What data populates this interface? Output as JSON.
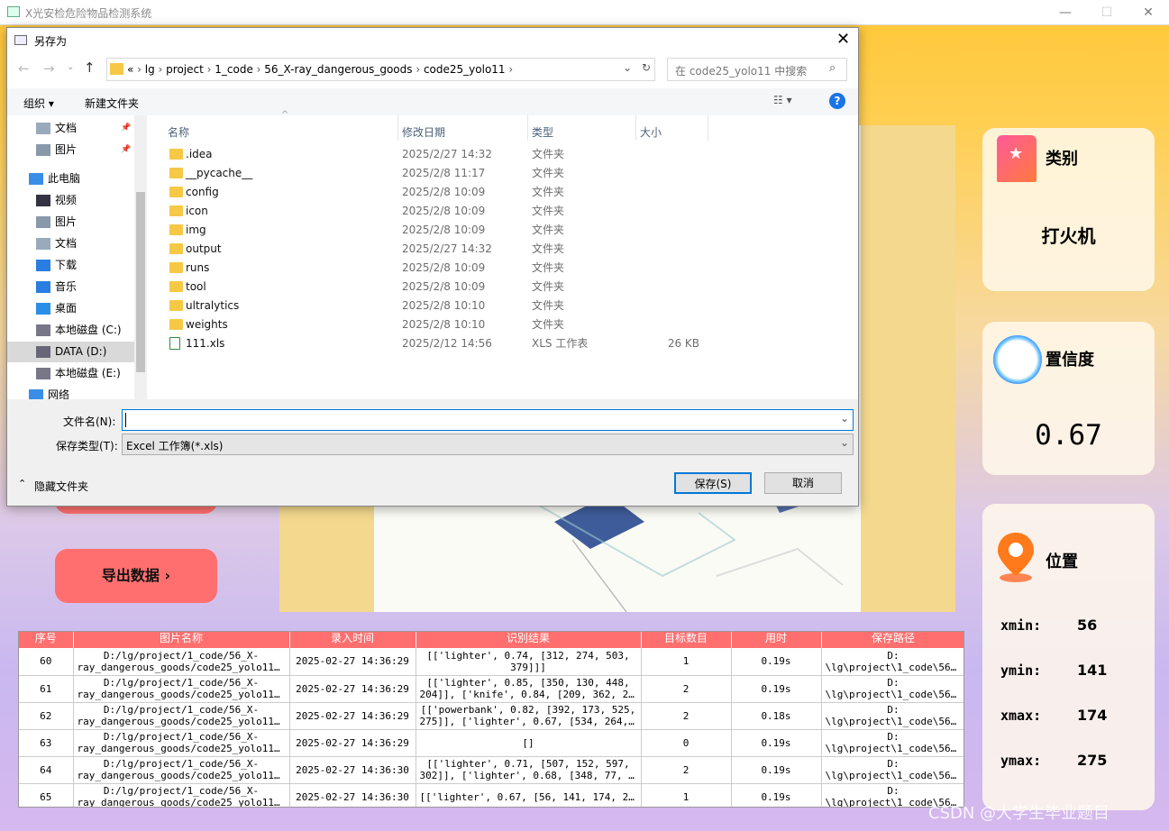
{
  "window": {
    "title": "X光安检危险物品检测系统",
    "min": "—",
    "max": "☐",
    "close": "✕"
  },
  "sidebar_buttons": {
    "export_label": "导出数据 ›"
  },
  "result_cards": {
    "category": {
      "title": "类别",
      "value": "打火机"
    },
    "confidence": {
      "title": "置信度",
      "value": "0.67"
    },
    "position": {
      "title": "位置",
      "xmin_label": "xmin:",
      "xmin": "56",
      "ymin_label": "ymin:",
      "ymin": "141",
      "xmax_label": "xmax:",
      "xmax": "174",
      "ymax_label": "ymax:",
      "ymax": "275"
    }
  },
  "table": {
    "headers": [
      "序号",
      "图片名称",
      "录入时间",
      "识别结果",
      "目标数目",
      "用时",
      "保存路径"
    ],
    "rows": [
      {
        "id": "60",
        "name1": "D:/lg/project/1_code/56_X-",
        "name2": "ray_dangerous_goods/code25_yolo11/im…",
        "time": "2025-02-27 14:36:29",
        "res1": "[['lighter', 0.74, [312, 274, 503,",
        "res2": "379]]]",
        "count": "1",
        "dur": "0.19s",
        "path1": "D:",
        "path2": "\\lg\\project\\1_code\\56_X…"
      },
      {
        "id": "61",
        "name1": "D:/lg/project/1_code/56_X-",
        "name2": "ray_dangerous_goods/code25_yolo11/im…",
        "time": "2025-02-27 14:36:29",
        "res1": "[['lighter', 0.85, [350, 130, 448,",
        "res2": "204]], ['knife', 0.84, [209, 362, 267,…",
        "count": "2",
        "dur": "0.19s",
        "path1": "D:",
        "path2": "\\lg\\project\\1_code\\56_X…"
      },
      {
        "id": "62",
        "name1": "D:/lg/project/1_code/56_X-",
        "name2": "ray_dangerous_goods/code25_yolo11/im…",
        "time": "2025-02-27 14:36:29",
        "res1": "[['powerbank', 0.82, [392, 173, 525,",
        "res2": "275]], ['lighter', 0.67, [534, 264, 59…",
        "count": "2",
        "dur": "0.18s",
        "path1": "D:",
        "path2": "\\lg\\project\\1_code\\56_X…"
      },
      {
        "id": "63",
        "name1": "D:/lg/project/1_code/56_X-",
        "name2": "ray_dangerous_goods/code25_yolo11/im…",
        "time": "2025-02-27 14:36:29",
        "res1": "[]",
        "res2": "",
        "count": "0",
        "dur": "0.19s",
        "path1": "D:",
        "path2": "\\lg\\project\\1_code\\56_X…"
      },
      {
        "id": "64",
        "name1": "D:/lg/project/1_code/56_X-",
        "name2": "ray_dangerous_goods/code25_yolo11/im…",
        "time": "2025-02-27 14:36:30",
        "res1": "[['lighter', 0.71, [507, 152, 597,",
        "res2": "302]], ['lighter', 0.68, [348, 77, 413…",
        "count": "2",
        "dur": "0.19s",
        "path1": "D:",
        "path2": "\\lg\\project\\1_code\\56_X…"
      },
      {
        "id": "65",
        "name1": "D:/lg/project/1_code/56_X-",
        "name2": "ray_dangerous_goods/code25_yolo11/im…",
        "time": "2025-02-27 14:36:30",
        "res1": "[['lighter', 0.67, [56, 141, 174, 275]]]",
        "res2": "",
        "count": "1",
        "dur": "0.19s",
        "path1": "D:",
        "path2": "\\lg\\project\\1_code\\56_X…"
      }
    ]
  },
  "watermark": "CSDN @大学生毕业题目",
  "dialog": {
    "title": "另存为",
    "breadcrumb": [
      "«",
      "lg",
      "project",
      "1_code",
      "56_X-ray_dangerous_goods",
      "code25_yolo11"
    ],
    "search_placeholder": "在 code25_yolo11 中搜索",
    "organize": "组织 ▾",
    "new_folder": "新建文件夹",
    "nav_items": [
      "文档",
      "图片",
      "此电脑",
      "视频",
      "图片",
      "文档",
      "下载",
      "音乐",
      "桌面",
      "本地磁盘 (C:)",
      "DATA (D:)",
      "本地磁盘 (E:)",
      "网络"
    ],
    "columns": [
      "名称",
      "修改日期",
      "类型",
      "大小"
    ],
    "files": [
      {
        "name": ".idea",
        "date": "2025/2/27 14:32",
        "type": "文件夹",
        "size": ""
      },
      {
        "name": "__pycache__",
        "date": "2025/2/8 11:17",
        "type": "文件夹",
        "size": ""
      },
      {
        "name": "config",
        "date": "2025/2/8 10:09",
        "type": "文件夹",
        "size": ""
      },
      {
        "name": "icon",
        "date": "2025/2/8 10:09",
        "type": "文件夹",
        "size": ""
      },
      {
        "name": "img",
        "date": "2025/2/8 10:09",
        "type": "文件夹",
        "size": ""
      },
      {
        "name": "output",
        "date": "2025/2/27 14:32",
        "type": "文件夹",
        "size": ""
      },
      {
        "name": "runs",
        "date": "2025/2/8 10:09",
        "type": "文件夹",
        "size": ""
      },
      {
        "name": "tool",
        "date": "2025/2/8 10:09",
        "type": "文件夹",
        "size": ""
      },
      {
        "name": "ultralytics",
        "date": "2025/2/8 10:10",
        "type": "文件夹",
        "size": ""
      },
      {
        "name": "weights",
        "date": "2025/2/8 10:10",
        "type": "文件夹",
        "size": ""
      },
      {
        "name": "111.xls",
        "date": "2025/2/12 14:56",
        "type": "XLS 工作表",
        "size": "26 KB"
      }
    ],
    "filename_label": "文件名(N):",
    "filename_value": "",
    "filetype_label": "保存类型(T):",
    "filetype_value": "Excel 工作簿(*.xls)",
    "hide_folders": "隐藏文件夹",
    "save": "保存(S)",
    "cancel": "取消"
  }
}
